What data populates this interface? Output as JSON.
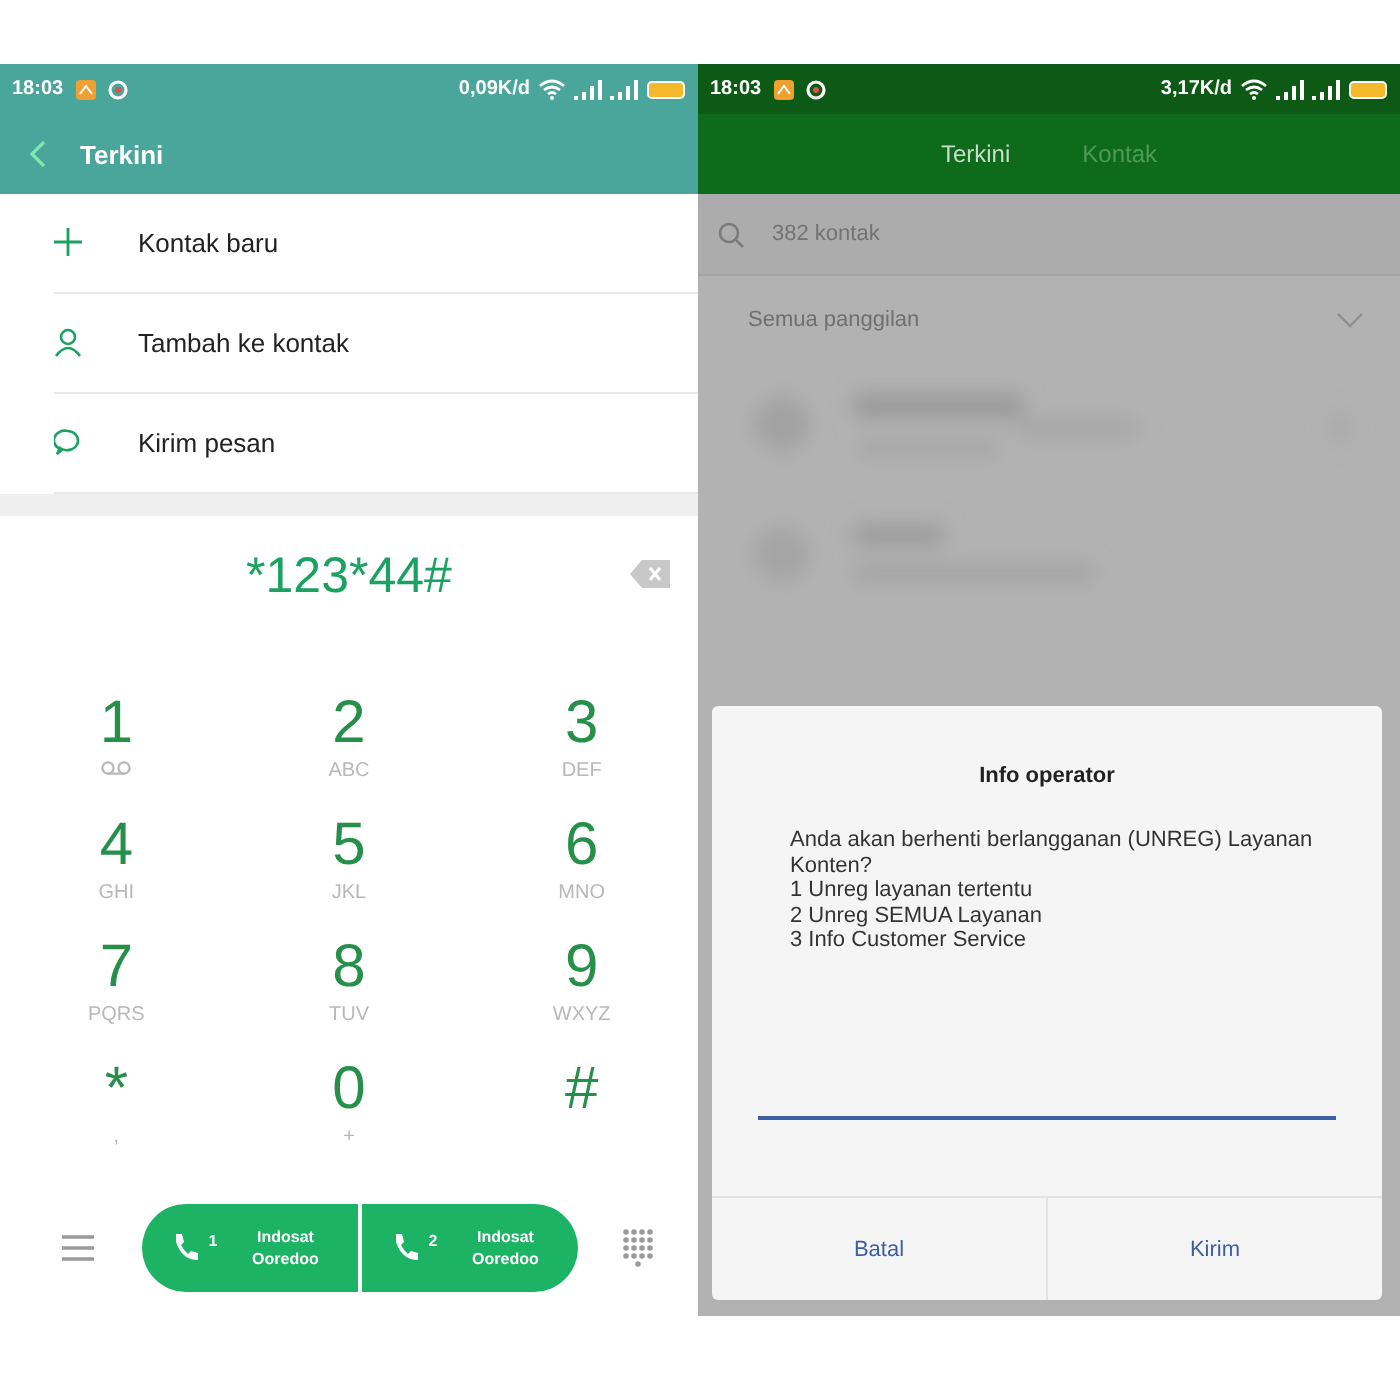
{
  "left_screen": {
    "status_bar": {
      "time": "18:03",
      "speed": "0,09K/d"
    },
    "header": {
      "title": "Terkini"
    },
    "actions": [
      {
        "kind": "add",
        "label": "Kontak baru"
      },
      {
        "kind": "person",
        "label": "Tambah ke kontak"
      },
      {
        "kind": "message",
        "label": "Kirim pesan"
      }
    ],
    "dialed_number": "*123*44#",
    "keypad": [
      {
        "digit": "1",
        "kind": "voicemail"
      },
      {
        "digit": "2",
        "kind": "letters",
        "letters": "ABC"
      },
      {
        "digit": "3",
        "kind": "letters",
        "letters": "DEF"
      },
      {
        "digit": "4",
        "kind": "letters",
        "letters": "GHI"
      },
      {
        "digit": "5",
        "kind": "letters",
        "letters": "JKL"
      },
      {
        "digit": "6",
        "kind": "letters",
        "letters": "MNO"
      },
      {
        "digit": "7",
        "kind": "letters",
        "letters": "PQRS"
      },
      {
        "digit": "8",
        "kind": "letters",
        "letters": "TUV"
      },
      {
        "digit": "9",
        "kind": "letters",
        "letters": "WXYZ"
      },
      {
        "digit": "*",
        "kind": "letters",
        "letters": ","
      },
      {
        "digit": "0",
        "kind": "letters",
        "letters": "+"
      },
      {
        "digit": "#",
        "kind": "letters"
      }
    ],
    "sim_buttons": [
      {
        "sim": "1",
        "label": "Indosat Ooredoo"
      },
      {
        "sim": "2",
        "label": "Indosat Ooredoo"
      }
    ]
  },
  "right_screen": {
    "status_bar": {
      "time": "18:03",
      "speed": "3,17K/d"
    },
    "tabs": [
      {
        "label": "Terkini",
        "selected": true
      },
      {
        "label": "Kontak",
        "selected": false
      }
    ],
    "search": {
      "placeholder": "382 kontak"
    },
    "filter": {
      "label": "Semua panggilan"
    },
    "dialog": {
      "title": "Info operator",
      "message": "Anda akan berhenti berlangganan (UNREG) Layanan Konten?\n1 Unreg layanan tertentu\n2 Unreg SEMUA Layanan\n3 Info Customer Service",
      "buttons": [
        "Batal",
        "Kirim"
      ]
    }
  }
}
